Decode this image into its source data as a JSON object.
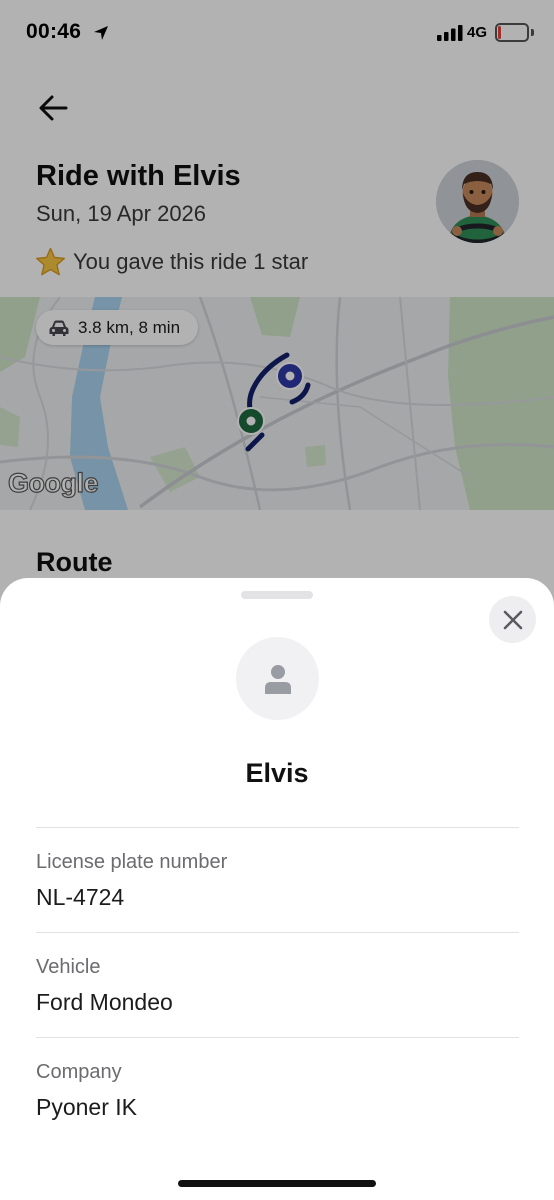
{
  "status_bar": {
    "time": "00:46",
    "network": "4G",
    "battery_level": "11",
    "icons": [
      "location-arrow-icon",
      "cellular-signal-icon",
      "battery-icon"
    ]
  },
  "ride": {
    "title": "Ride with Elvis",
    "date": "Sun, 19 Apr 2026",
    "rating_text": "You gave this ride 1 star",
    "rating_icon": "star-icon"
  },
  "map": {
    "trip_summary": "3.8 km, 8 min",
    "provider_logo": "Google",
    "pickup_color": "#1f6b3f",
    "dropoff_color": "#2f3aa8",
    "route_color": "#14206a"
  },
  "route_section": {
    "heading": "Route"
  },
  "driver_sheet": {
    "name": "Elvis",
    "fields": [
      {
        "label": "License plate number",
        "value": "NL-4724"
      },
      {
        "label": "Vehicle",
        "value": "Ford Mondeo"
      },
      {
        "label": "Company",
        "value": "Pyoner IK"
      }
    ]
  }
}
